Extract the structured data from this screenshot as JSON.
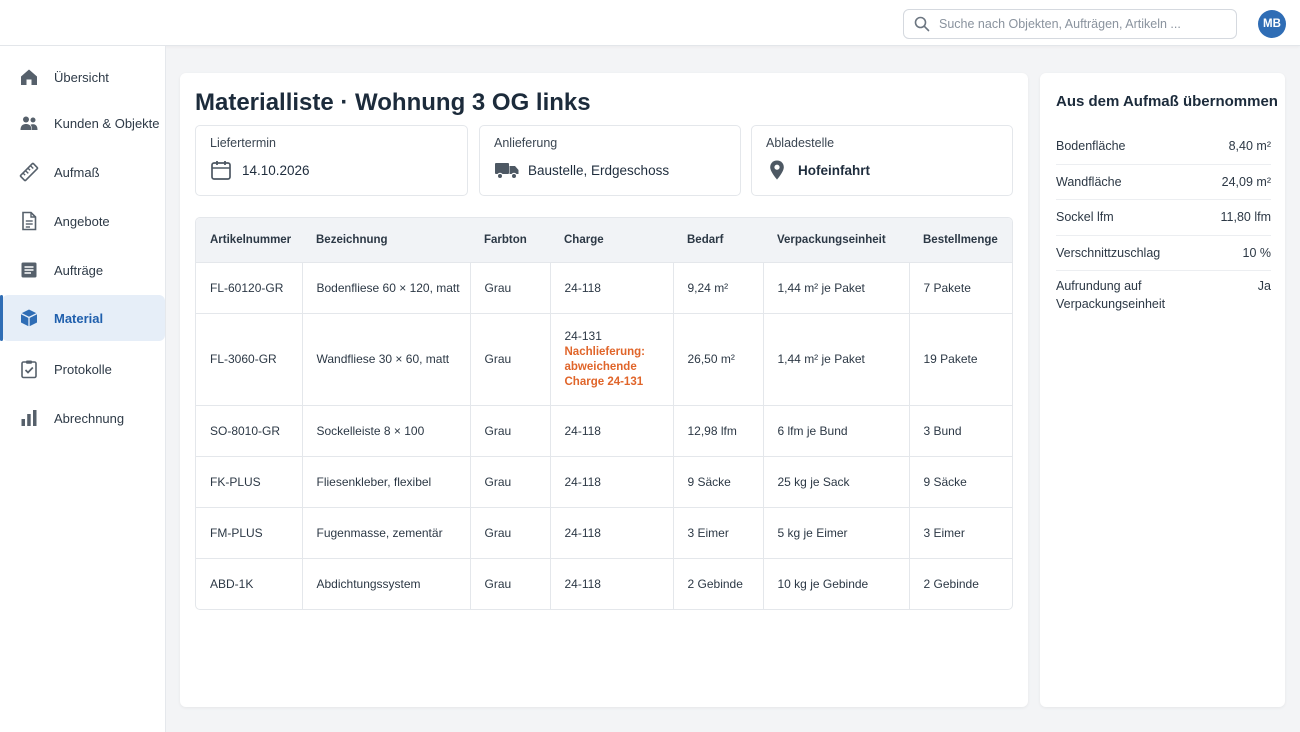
{
  "search": {
    "placeholder": "Suche nach Objekten, Aufträgen, Artikeln ..."
  },
  "user": {
    "initials": "MB"
  },
  "sidebar": {
    "items": [
      {
        "label": "Übersicht",
        "icon": "home-icon"
      },
      {
        "label": "Kunden & Objekte",
        "icon": "users-icon"
      },
      {
        "label": "Aufmaß",
        "icon": "ruler-icon"
      },
      {
        "label": "Angebote",
        "icon": "document-icon"
      },
      {
        "label": "Aufträge",
        "icon": "list-icon"
      },
      {
        "label": "Material",
        "icon": "box-icon",
        "active": true
      },
      {
        "label": "Protokolle",
        "icon": "clipboard-check-icon"
      },
      {
        "label": "Abrechnung",
        "icon": "bar-chart-icon"
      }
    ]
  },
  "main": {
    "title": "Materialliste · Wohnung 3 OG links",
    "info": {
      "liefertermin": {
        "label": "Liefertermin",
        "value": "14.10.2026"
      },
      "anlieferung": {
        "label": "Anlieferung",
        "value": "Baustelle, Erdgeschoss"
      },
      "abladestelle": {
        "label": "Abladestelle",
        "value": "Hofeinfahrt"
      }
    },
    "table": {
      "headers": [
        "Artikelnummer",
        "Bezeichnung",
        "Farbton",
        "Charge",
        "Bedarf",
        "Verpackungseinheit",
        "Bestellmenge"
      ],
      "rows": [
        {
          "artikel": "FL-60120-GR",
          "bezeichnung": "Bodenfliese 60 × 120, matt",
          "farbton": "Grau",
          "charge": "24-118",
          "note": "",
          "bedarf": "9,24 m²",
          "ve": "1,44 m² je Paket",
          "menge": "7 Pakete"
        },
        {
          "artikel": "FL-3060-GR",
          "bezeichnung": "Wandfliese 30 × 60, matt",
          "farbton": "Grau",
          "charge": "24-131",
          "note": "Nachlieferung: abweichende Charge 24-131",
          "bedarf": "26,50 m²",
          "ve": "1,44 m² je Paket",
          "menge": "19 Pakete"
        },
        {
          "artikel": "SO-8010-GR",
          "bezeichnung": "Sockelleiste 8 × 100",
          "farbton": "Grau",
          "charge": "24-118",
          "note": "",
          "bedarf": "12,98 lfm",
          "ve": "6 lfm je Bund",
          "menge": "3 Bund"
        },
        {
          "artikel": "FK-PLUS",
          "bezeichnung": "Fliesenkleber, flexibel",
          "farbton": "Grau",
          "charge": "24-118",
          "note": "",
          "bedarf": "9 Säcke",
          "ve": "25 kg je Sack",
          "menge": "9 Säcke"
        },
        {
          "artikel": "FM-PLUS",
          "bezeichnung": "Fugenmasse, zementär",
          "farbton": "Grau",
          "charge": "24-118",
          "note": "",
          "bedarf": "3 Eimer",
          "ve": "5 kg je Eimer",
          "menge": "3 Eimer"
        },
        {
          "artikel": "ABD-1K",
          "bezeichnung": "Abdichtungssystem",
          "farbton": "Grau",
          "charge": "24-118",
          "note": "",
          "bedarf": "2 Gebinde",
          "ve": "10 kg je Gebinde",
          "menge": "2 Gebinde"
        }
      ]
    }
  },
  "aufmass": {
    "title": "Aus dem Aufmaß übernommen",
    "rows": [
      {
        "label": "Bodenfläche",
        "value": "8,40 m²"
      },
      {
        "label": "Wandfläche",
        "value": "24,09 m²"
      },
      {
        "label": "Sockel lfm",
        "value": "11,80 lfm"
      },
      {
        "label": "Verschnittzuschlag",
        "value": "10 %"
      },
      {
        "label": "Aufrundung auf Verpackungseinheit",
        "value": "Ja"
      }
    ]
  },
  "colors": {
    "accent": "#2f6db5",
    "active_bg": "#e6eef8",
    "warning": "#e0652a"
  }
}
